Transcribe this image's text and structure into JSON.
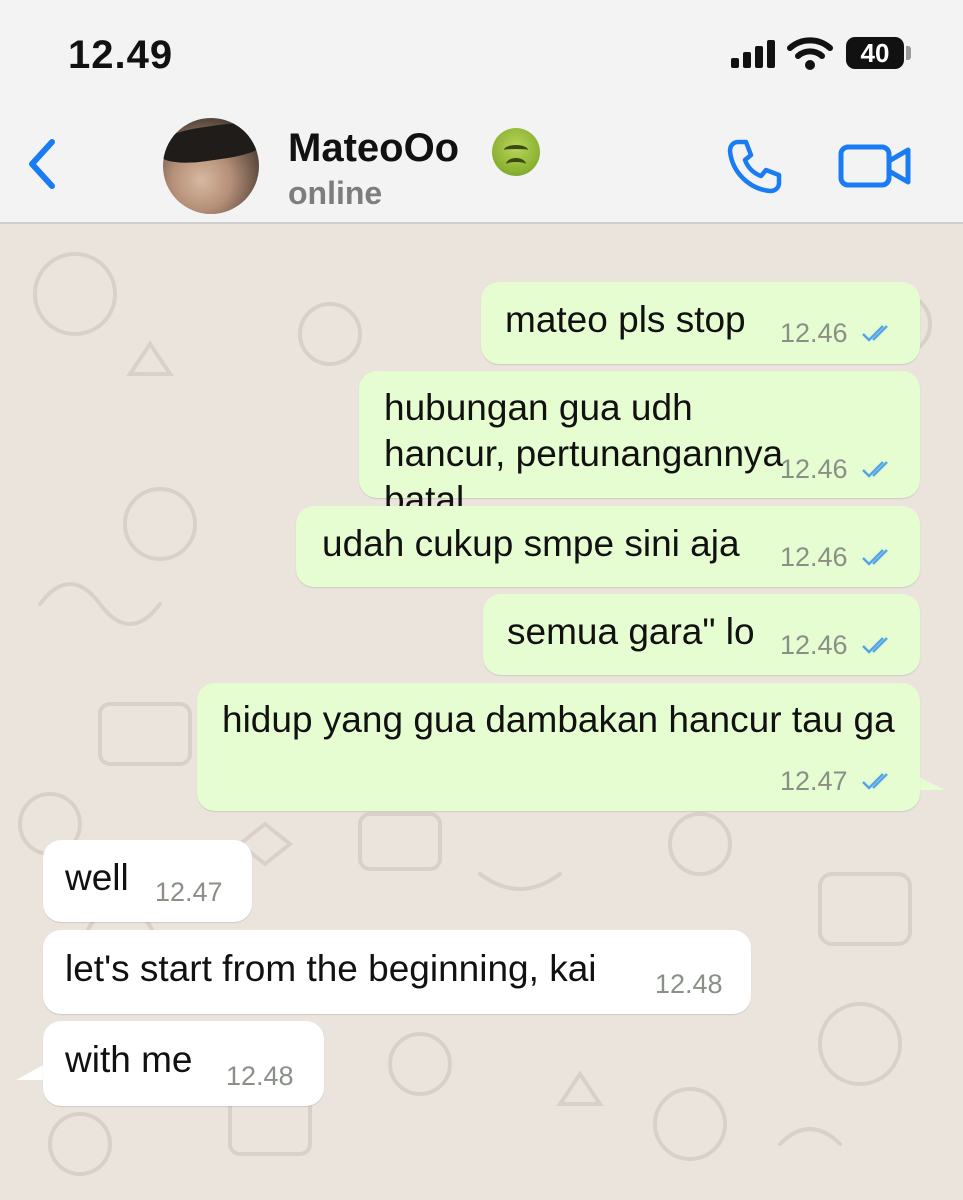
{
  "status_bar": {
    "time": "12.49",
    "battery": "40"
  },
  "header": {
    "name": "MateoOo",
    "status": "online"
  },
  "icons": {
    "back": "chevron-left-icon",
    "call": "phone-icon",
    "video": "video-camera-icon",
    "read": "double-check-icon",
    "contact_emoji": "nauseated-face-emoji"
  },
  "colors": {
    "accent": "#1a7cf3",
    "outgoing": "#e6fdd2",
    "incoming": "#ffffff",
    "read_ticks": "#53a6e6"
  },
  "messages": [
    {
      "direction": "out",
      "text": "mateo pls stop",
      "time": "12.46"
    },
    {
      "direction": "out",
      "text": "hubungan gua udh hancur, pertunangannya batal",
      "time": "12.46"
    },
    {
      "direction": "out",
      "text": "udah cukup smpe sini aja",
      "time": "12.46"
    },
    {
      "direction": "out",
      "text": "semua gara\" lo",
      "time": "12.46"
    },
    {
      "direction": "out",
      "text": "hidup yang gua dambakan hancur tau ga",
      "time": "12.47"
    },
    {
      "direction": "in",
      "text": "well",
      "time": "12.47"
    },
    {
      "direction": "in",
      "text": "let's start from the beginning, kai",
      "time": "12.48"
    },
    {
      "direction": "in",
      "text": "with me",
      "time": "12.48"
    }
  ]
}
